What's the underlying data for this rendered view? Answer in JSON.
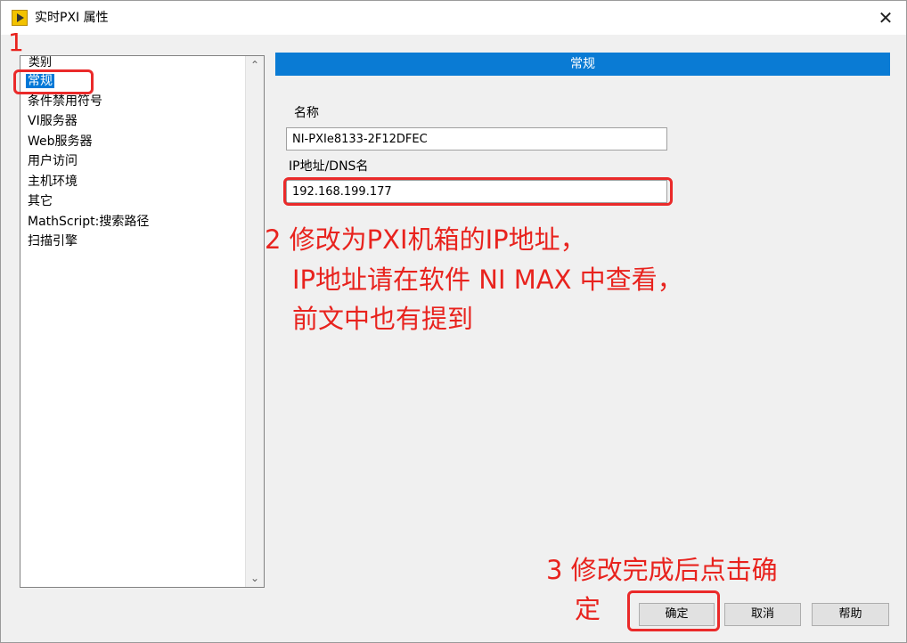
{
  "window": {
    "title": "实时PXI 属性",
    "close_glyph": "✕"
  },
  "category": {
    "header": "类别",
    "items": [
      {
        "label": "常规",
        "selected": true
      },
      {
        "label": "条件禁用符号"
      },
      {
        "label": "VI服务器"
      },
      {
        "label": "Web服务器"
      },
      {
        "label": "用户访问"
      },
      {
        "label": "主机环境"
      },
      {
        "label": "其它"
      },
      {
        "label": "MathScript:搜索路径"
      },
      {
        "label": "扫描引擎"
      }
    ],
    "scroll_up_glyph": "⌃",
    "scroll_down_glyph": "⌄"
  },
  "section": {
    "header": "常规"
  },
  "form": {
    "name_label": "名称",
    "name_value": "NI-PXIe8133-2F12DFEC",
    "ip_label": "IP地址/DNS名",
    "ip_value": "192.168.199.177"
  },
  "buttons": {
    "ok": "确定",
    "cancel": "取消",
    "help": "帮助"
  },
  "annotations": {
    "step1": "1",
    "step2_line1": "2  修改为PXI机箱的IP地址，",
    "step2_line2": "IP地址请在软件 NI MAX 中查看，",
    "step2_line3": "前文中也有提到",
    "step3_line1": "3  修改完成后点击确",
    "step3_line2": "定"
  },
  "colors": {
    "accent": "#0a7bd4",
    "annotation": "#e8231e",
    "selection": "#0078d7"
  }
}
